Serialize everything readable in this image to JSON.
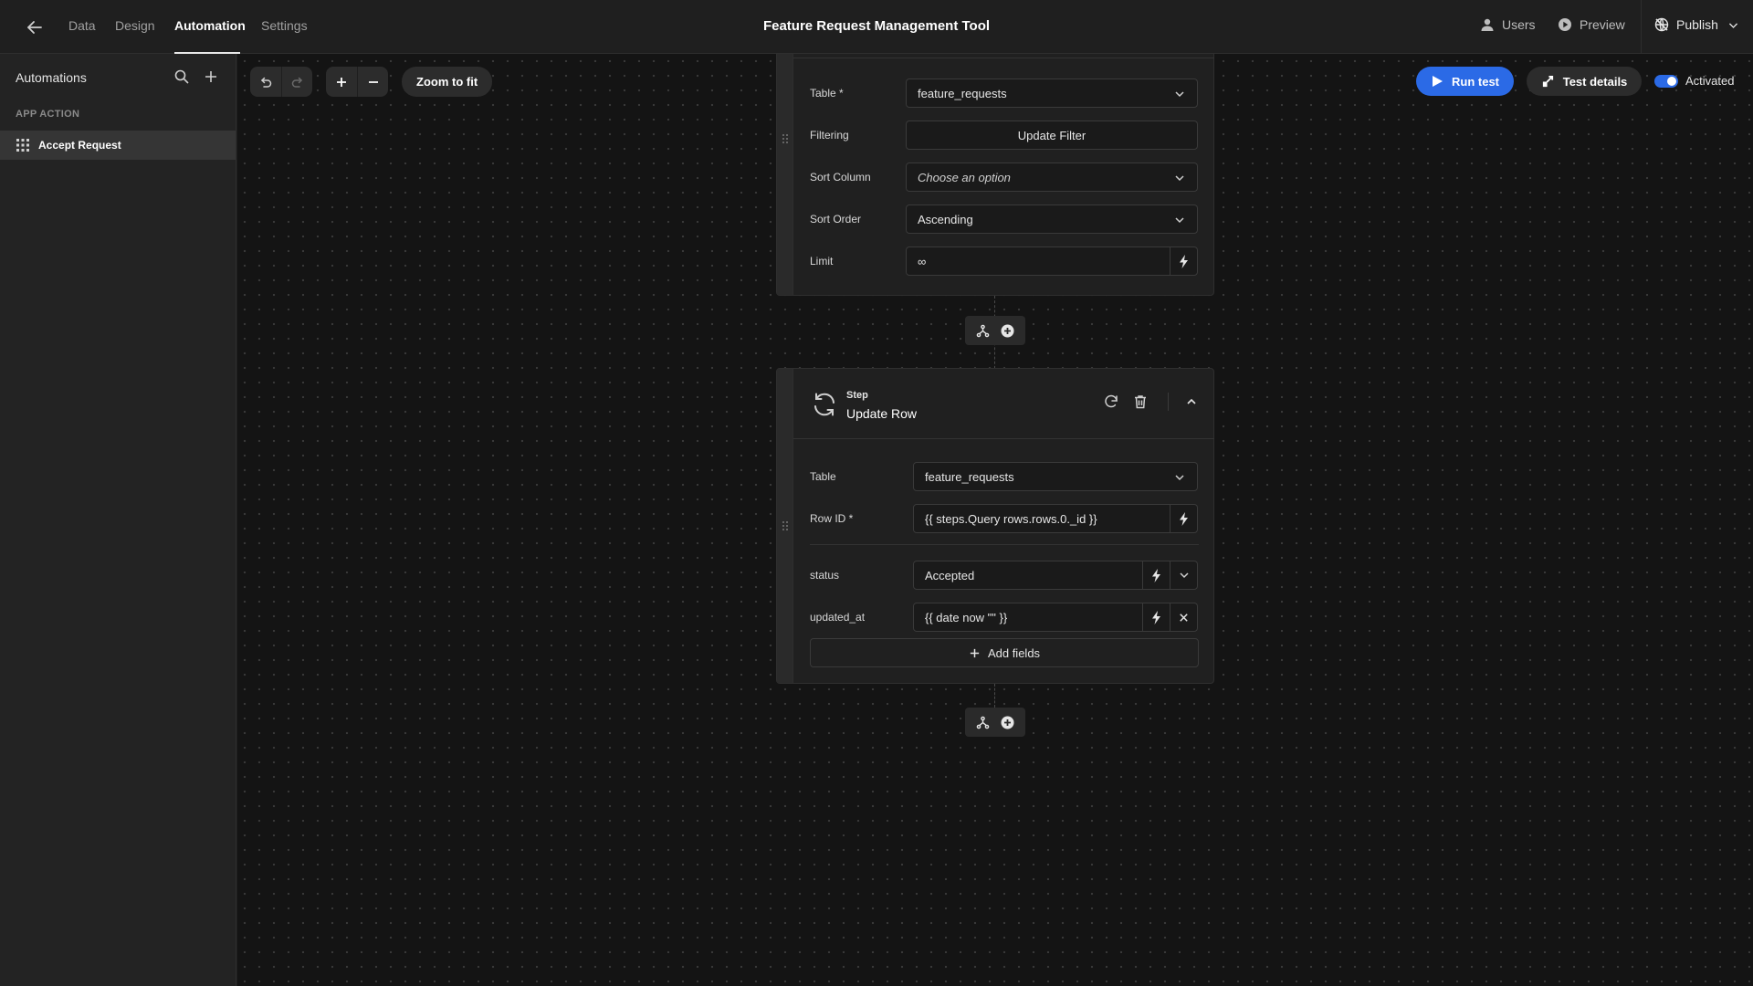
{
  "app": {
    "title": "Feature Request Management Tool",
    "nav": [
      "Data",
      "Design",
      "Automation",
      "Settings"
    ],
    "active_tab": "Automation",
    "actions": {
      "users": "Users",
      "preview": "Preview",
      "publish": "Publish"
    }
  },
  "sidebar": {
    "title": "Automations",
    "section": "APP ACTION",
    "items": [
      {
        "label": "Accept Request",
        "icon": "grid-icon"
      }
    ]
  },
  "toolbar": {
    "zoom_fit": "Zoom to fit",
    "run_test": "Run test",
    "test_details": "Test details",
    "activated_label": "Activated",
    "activated": true
  },
  "query_step": {
    "fields": [
      {
        "label": "Table *",
        "value": "feature_requests",
        "type": "select"
      },
      {
        "label": "Filtering",
        "value": "Update Filter",
        "type": "button"
      },
      {
        "label": "Sort Column",
        "value": "Choose an option",
        "type": "select-placeholder"
      },
      {
        "label": "Sort Order",
        "value": "Ascending",
        "type": "select"
      },
      {
        "label": "Limit",
        "value": "∞",
        "type": "binding"
      }
    ]
  },
  "update_step": {
    "kicker": "Step",
    "title": "Update Row",
    "fields": [
      {
        "label": "Table",
        "value": "feature_requests",
        "type": "select"
      },
      {
        "label": "Row ID *",
        "value": "{{ steps.Query rows.rows.0._id }}",
        "type": "binding"
      },
      {
        "label": "status",
        "value": "Accepted",
        "type": "binding-select"
      },
      {
        "label": "updated_at",
        "value": "{{ date now \"\" }}",
        "type": "binding-clear"
      }
    ],
    "add_fields": "Add fields"
  },
  "colors": {
    "accent": "#2b6ae6",
    "canvas": "#141414",
    "panel": "#232323",
    "card": "#202020"
  }
}
